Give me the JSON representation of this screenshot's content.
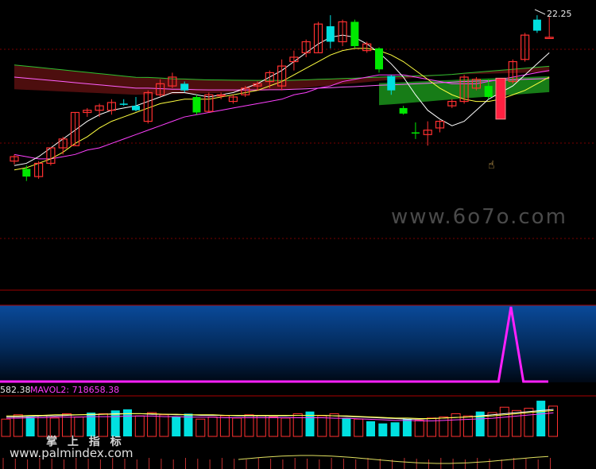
{
  "price_label": "22.25",
  "volume_panel": {
    "mavol1_label": "582.38",
    "mavol2_label": "MAVOL2: 718658.38"
  },
  "watermarks": {
    "site_6070": "www.6o7o.com",
    "chinese": "掌 上 指 标",
    "palmindex": "www.palmindex.com"
  },
  "colors": {
    "up": "#ff3030",
    "down": "#00e0e0",
    "green_candle": "#00e800",
    "ma5": "#ffffff",
    "ma10": "#ffff40",
    "ma20": "#ff40ff",
    "ma60": "#ff60ff",
    "signal": "#ff20ff"
  },
  "chart_data": [
    {
      "type": "candlestick",
      "title": "",
      "ylim": [
        12.2,
        22.7
      ],
      "candles": [
        {
          "o": 15.7,
          "h": 16.0,
          "l": 15.55,
          "c": 15.9,
          "color": "red"
        },
        {
          "o": 15.35,
          "h": 15.5,
          "l": 14.8,
          "c": 15.0,
          "color": "green"
        },
        {
          "o": 15.0,
          "h": 15.7,
          "l": 14.9,
          "c": 15.6,
          "color": "red"
        },
        {
          "o": 15.6,
          "h": 16.3,
          "l": 15.5,
          "c": 16.3,
          "color": "red"
        },
        {
          "o": 16.3,
          "h": 16.8,
          "l": 16.0,
          "c": 16.7,
          "color": "red"
        },
        {
          "o": 16.4,
          "h": 17.9,
          "l": 16.4,
          "c": 17.9,
          "color": "red"
        },
        {
          "o": 17.9,
          "h": 18.1,
          "l": 17.7,
          "c": 18.0,
          "color": "red"
        },
        {
          "o": 18.0,
          "h": 18.3,
          "l": 17.7,
          "c": 18.2,
          "color": "red"
        },
        {
          "o": 18.0,
          "h": 18.5,
          "l": 17.8,
          "c": 18.35,
          "color": "red"
        },
        {
          "o": 18.3,
          "h": 18.5,
          "l": 18.2,
          "c": 18.3,
          "color": "cyan"
        },
        {
          "o": 18.2,
          "h": 18.6,
          "l": 17.95,
          "c": 18.0,
          "color": "cyan"
        },
        {
          "o": 17.5,
          "h": 18.9,
          "l": 17.4,
          "c": 18.8,
          "color": "red"
        },
        {
          "o": 18.7,
          "h": 19.4,
          "l": 18.6,
          "c": 19.2,
          "color": "red"
        },
        {
          "o": 19.1,
          "h": 19.7,
          "l": 19.0,
          "c": 19.5,
          "color": "red"
        },
        {
          "o": 19.2,
          "h": 19.3,
          "l": 18.8,
          "c": 18.9,
          "color": "cyan"
        },
        {
          "o": 18.6,
          "h": 18.7,
          "l": 17.8,
          "c": 17.9,
          "color": "green"
        },
        {
          "o": 17.95,
          "h": 18.8,
          "l": 17.9,
          "c": 18.7,
          "color": "red"
        },
        {
          "o": 18.7,
          "h": 18.8,
          "l": 18.5,
          "c": 18.7,
          "color": "red"
        },
        {
          "o": 18.4,
          "h": 18.7,
          "l": 18.3,
          "c": 18.6,
          "color": "red"
        },
        {
          "o": 18.7,
          "h": 19.1,
          "l": 18.6,
          "c": 19.0,
          "color": "red"
        },
        {
          "o": 19.1,
          "h": 19.3,
          "l": 18.9,
          "c": 19.2,
          "color": "red"
        },
        {
          "o": 19.3,
          "h": 19.8,
          "l": 19.0,
          "c": 19.7,
          "color": "red"
        },
        {
          "o": 19.1,
          "h": 20.3,
          "l": 18.9,
          "c": 20.0,
          "color": "red"
        },
        {
          "o": 20.2,
          "h": 20.7,
          "l": 19.8,
          "c": 20.4,
          "color": "red"
        },
        {
          "o": 20.6,
          "h": 21.2,
          "l": 20.4,
          "c": 21.1,
          "color": "red"
        },
        {
          "o": 20.6,
          "h": 22.0,
          "l": 20.6,
          "c": 21.9,
          "color": "red"
        },
        {
          "o": 21.8,
          "h": 22.3,
          "l": 20.8,
          "c": 21.1,
          "color": "cyan"
        },
        {
          "o": 21.1,
          "h": 22.1,
          "l": 20.9,
          "c": 22.0,
          "color": "red"
        },
        {
          "o": 22.0,
          "h": 22.1,
          "l": 20.8,
          "c": 20.9,
          "color": "green"
        },
        {
          "o": 20.7,
          "h": 21.1,
          "l": 20.6,
          "c": 21.0,
          "color": "red"
        },
        {
          "o": 20.8,
          "h": 20.85,
          "l": 19.7,
          "c": 19.85,
          "color": "green"
        },
        {
          "o": 19.55,
          "h": 19.6,
          "l": 18.7,
          "c": 18.9,
          "color": "cyan"
        },
        {
          "o": 18.1,
          "h": 18.2,
          "l": 17.8,
          "c": 17.85,
          "color": "green"
        },
        {
          "o": 17.0,
          "h": 17.45,
          "l": 16.7,
          "c": 17.0,
          "color": "green"
        },
        {
          "o": 17.1,
          "h": 17.5,
          "l": 16.4,
          "c": 16.9,
          "color": "red"
        },
        {
          "o": 17.2,
          "h": 17.55,
          "l": 17.0,
          "c": 17.5,
          "color": "red"
        },
        {
          "o": 18.2,
          "h": 18.5,
          "l": 18.1,
          "c": 18.4,
          "color": "red"
        },
        {
          "o": 18.4,
          "h": 19.6,
          "l": 18.3,
          "c": 19.5,
          "color": "red"
        },
        {
          "o": 19.0,
          "h": 19.5,
          "l": 18.9,
          "c": 19.4,
          "color": "red"
        },
        {
          "o": 19.1,
          "h": 19.4,
          "l": 18.5,
          "c": 18.6,
          "color": "green"
        },
        {
          "o": 17.7,
          "h": 19.4,
          "l": 17.7,
          "c": 19.2,
          "color": "red"
        },
        {
          "o": 19.3,
          "h": 20.3,
          "l": 19.2,
          "c": 20.2,
          "color": "red"
        },
        {
          "o": 20.3,
          "h": 21.5,
          "l": 20.2,
          "c": 21.4,
          "color": "red"
        },
        {
          "o": 21.6,
          "h": 22.3,
          "l": 21.5,
          "c": 22.1,
          "color": "cyan"
        },
        {
          "o": 21.3,
          "h": 22.25,
          "l": 21.3,
          "c": 21.3,
          "color": "red"
        }
      ],
      "ma5": [
        15.5,
        15.6,
        15.9,
        16.3,
        16.7,
        17.1,
        17.5,
        17.8,
        18.0,
        18.1,
        18.2,
        18.4,
        18.6,
        18.8,
        18.8,
        18.7,
        18.6,
        18.7,
        18.8,
        19.0,
        19.2,
        19.5,
        19.8,
        20.2,
        20.6,
        21.0,
        21.3,
        21.4,
        21.3,
        21.0,
        20.6,
        20.1,
        19.5,
        18.7,
        18.0,
        17.6,
        17.3,
        17.5,
        18.0,
        18.5,
        18.8,
        19.1,
        19.6,
        20.1,
        20.6
      ],
      "ma10": [
        15.3,
        15.4,
        15.6,
        15.8,
        16.1,
        16.5,
        16.8,
        17.2,
        17.5,
        17.7,
        17.9,
        18.1,
        18.3,
        18.4,
        18.5,
        18.5,
        18.5,
        18.6,
        18.7,
        18.8,
        18.9,
        19.1,
        19.3,
        19.6,
        19.9,
        20.2,
        20.5,
        20.7,
        20.8,
        20.8,
        20.7,
        20.5,
        20.2,
        19.8,
        19.4,
        19.0,
        18.7,
        18.5,
        18.4,
        18.4,
        18.5,
        18.7,
        18.9,
        19.2,
        19.5
      ],
      "ma20": [
        16.0,
        15.9,
        15.8,
        15.8,
        15.9,
        16.0,
        16.2,
        16.3,
        16.5,
        16.7,
        16.9,
        17.1,
        17.3,
        17.5,
        17.7,
        17.8,
        17.9,
        18.0,
        18.1,
        18.2,
        18.3,
        18.4,
        18.5,
        18.7,
        18.8,
        19.0,
        19.1,
        19.3,
        19.4,
        19.5,
        19.6,
        19.6,
        19.6,
        19.5,
        19.4,
        19.3,
        19.2,
        19.2,
        19.2,
        19.3,
        19.4,
        19.5,
        19.6,
        19.7,
        19.8
      ],
      "ma60": [
        19.5,
        19.45,
        19.4,
        19.35,
        19.3,
        19.25,
        19.2,
        19.15,
        19.1,
        19.05,
        19.0,
        19.0,
        18.98,
        18.95,
        18.95,
        18.93,
        18.92,
        18.92,
        18.92,
        18.92,
        18.92,
        18.93,
        18.93,
        18.95,
        18.97,
        19.0,
        19.02,
        19.05,
        19.07,
        19.1,
        19.13,
        19.15,
        19.17,
        19.2,
        19.22,
        19.25,
        19.27,
        19.3,
        19.32,
        19.34,
        19.36,
        19.38,
        19.4,
        19.42,
        19.44
      ]
    },
    {
      "type": "area",
      "title": "",
      "values": [
        0,
        0,
        0,
        0,
        0,
        0,
        0,
        0,
        0,
        0,
        0,
        0,
        0,
        0,
        0,
        0,
        0,
        0,
        0,
        0,
        0,
        0,
        0,
        0,
        0,
        0,
        0,
        0,
        0,
        0,
        0,
        0,
        0,
        0,
        0,
        0,
        0,
        0,
        0,
        0,
        0,
        1,
        0,
        0,
        0
      ],
      "ylim": [
        0,
        1
      ]
    },
    {
      "type": "bar",
      "title": "",
      "values": [
        16,
        20,
        18,
        19,
        17,
        21,
        18,
        22,
        21,
        24,
        25,
        19,
        22,
        20,
        18,
        21,
        16,
        18,
        19,
        17,
        20,
        19,
        18,
        17,
        21,
        23,
        19,
        21,
        17,
        16,
        14,
        12,
        13,
        16,
        15,
        17,
        18,
        21,
        19,
        23,
        22,
        27,
        24,
        26,
        33,
        28
      ],
      "colors": [
        "red",
        "red",
        "cyan",
        "red",
        "red",
        "red",
        "red",
        "cyan",
        "red",
        "cyan",
        "cyan",
        "red",
        "red",
        "red",
        "cyan",
        "cyan",
        "red",
        "red",
        "red",
        "red",
        "red",
        "red",
        "red",
        "red",
        "red",
        "cyan",
        "red",
        "red",
        "cyan",
        "red",
        "cyan",
        "cyan",
        "cyan",
        "cyan",
        "red",
        "red",
        "red",
        "red",
        "red",
        "cyan",
        "red",
        "red",
        "red",
        "red",
        "cyan",
        "red"
      ],
      "mavol1": [
        18,
        18,
        18.5,
        19,
        19,
        19.5,
        20,
        20,
        20.5,
        21,
        21,
        21,
        20.5,
        20.5,
        20,
        20,
        19.5,
        19.5,
        19.5,
        19,
        19,
        19,
        19,
        19,
        19.5,
        19.5,
        19.5,
        19,
        18.5,
        18,
        17.5,
        17,
        16.5,
        16,
        16,
        16.5,
        17,
        17.5,
        18,
        19,
        20,
        21,
        22,
        23,
        24,
        25
      ],
      "mavol2": [
        19,
        19,
        19.5,
        19.5,
        20,
        20,
        20,
        20.5,
        20.5,
        20.5,
        21,
        21,
        21,
        20.5,
        20.5,
        20,
        20,
        20,
        19.5,
        19.5,
        19.5,
        19.5,
        19.5,
        19.5,
        19.5,
        19.5,
        19.5,
        19,
        19,
        18.5,
        18,
        17.5,
        17,
        17,
        16.5,
        16.5,
        17,
        17.5,
        18,
        18.5,
        19,
        20,
        21,
        22,
        23,
        24
      ]
    }
  ]
}
